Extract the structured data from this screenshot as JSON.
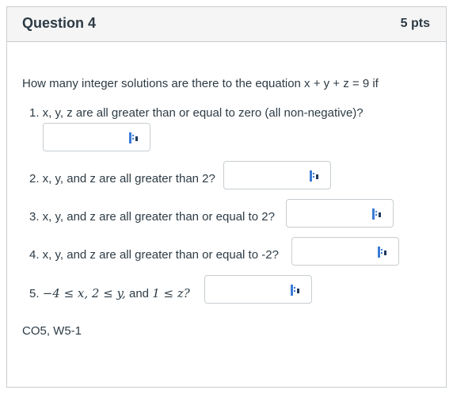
{
  "question": {
    "title": "Question 4",
    "points": "5 pts",
    "intro": "How many integer solutions are there to the equation x + y + z = 9 if",
    "parts": [
      {
        "label": "1. x, y, z are all greater than or equal to zero (all non-negative)?",
        "value": ""
      },
      {
        "label": "2. x, y, and z are all greater than 2?",
        "value": ""
      },
      {
        "label": "3. x, y, and z are all greater than or equal to 2?",
        "value": ""
      },
      {
        "label": "4. x, y, and z are all greater than or equal to -2?",
        "value": ""
      },
      {
        "label_prefix": "5.",
        "label_math": "−4 ≤ x, 2 ≤ y,",
        "label_and": "and",
        "label_math2": "1 ≤ z?",
        "value": ""
      }
    ],
    "footer": "CO5, W5-1"
  },
  "icons": {
    "answer_field_icon": "password-manager-icon"
  },
  "colors": {
    "header_bg": "#f5f5f5",
    "border": "#c7cdd1",
    "text": "#2d3b45"
  }
}
